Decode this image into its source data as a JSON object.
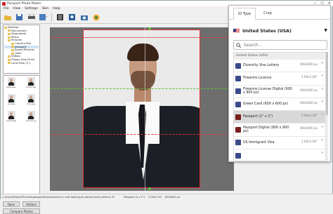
{
  "window": {
    "title": "Passport Photo Maker"
  },
  "menu": [
    "File",
    "View",
    "Settings",
    "Skin",
    "Help"
  ],
  "folder_tree": [
    {
      "label": "Desktop",
      "indent": 0
    },
    {
      "label": "Documents",
      "indent": 1
    },
    {
      "label": "Downloads",
      "indent": 1
    },
    {
      "label": "Music",
      "indent": 1
    },
    {
      "label": "Pictures",
      "indent": 1
    },
    {
      "label": "Camera Roll",
      "indent": 2
    },
    {
      "label": "passport",
      "indent": 2,
      "selected": true
    },
    {
      "label": "Saved Pictures",
      "indent": 2
    },
    {
      "label": "Upile",
      "indent": 2
    },
    {
      "label": "Videos",
      "indent": 1
    },
    {
      "label": "Floppy Disk Drive",
      "indent": 1
    },
    {
      "label": "Local Disk (C:)",
      "indent": 1
    }
  ],
  "thumbnails": [
    {
      "caption": "business.jpg"
    },
    {
      "caption": "dmitri.jpg"
    },
    {
      "caption": "girl.jpg"
    },
    {
      "caption": "man.jpg"
    },
    {
      "caption": "kid-passport.jpg"
    },
    {
      "caption": "woman.jpg"
    }
  ],
  "buttons": {
    "open": "Open",
    "actions": "Actions",
    "compare": "Compare Photos"
  },
  "status": {
    "path": "C:\\Users\\Fewer\\Pictures\\passport\\businessman-in-suit-looking-at-camera-over-white-b-379ll9... ",
    "doc": "Passport (2 x 2\")",
    "size": "2.00x2.00\"",
    "res": "600x600 px"
  },
  "id_panel": {
    "tabs": [
      "ID Type",
      "Crop"
    ],
    "active_tab": 0,
    "country": "United States (USA)",
    "search_placeholder": "Search...",
    "group": "United States (USA)",
    "documents": [
      {
        "name": "Diversity Visa Lottery",
        "size": "600x600 px",
        "icon": "plane-icon",
        "color": "#3b4a8a"
      },
      {
        "name": "Firearms Licence",
        "size": "2.00x2.00\"",
        "icon": "id-card-icon",
        "color": "#3b4a8a"
      },
      {
        "name": "Firearms License Digital (900 x 900 px)",
        "size": "900x900 px",
        "icon": "id-card-icon",
        "color": "#3b4a8a"
      },
      {
        "name": "Green Card (600 x 600 px)",
        "size": "600x600 px",
        "icon": "id-card-icon",
        "color": "#3b4a8a"
      },
      {
        "name": "Passport (2\" x 2\")",
        "size": "2.00x2.00\"",
        "icon": "passport-icon",
        "color": "#7a1f1f",
        "selected": true
      },
      {
        "name": "Passport Digital (900 x 900 px)",
        "size": "900x900 px",
        "icon": "passport-icon",
        "color": "#7a1f1f"
      },
      {
        "name": "US Immigrant Visa",
        "size": "2.00x2.00\"",
        "icon": "plane-icon",
        "color": "#3b4a8a"
      },
      {
        "name": "",
        "size": "",
        "icon": "plane-icon",
        "color": "#3b4a8a"
      }
    ]
  },
  "colors": {
    "accent": "#e03333",
    "guide": "#5bc236",
    "canvas": "#6e6e6e"
  }
}
